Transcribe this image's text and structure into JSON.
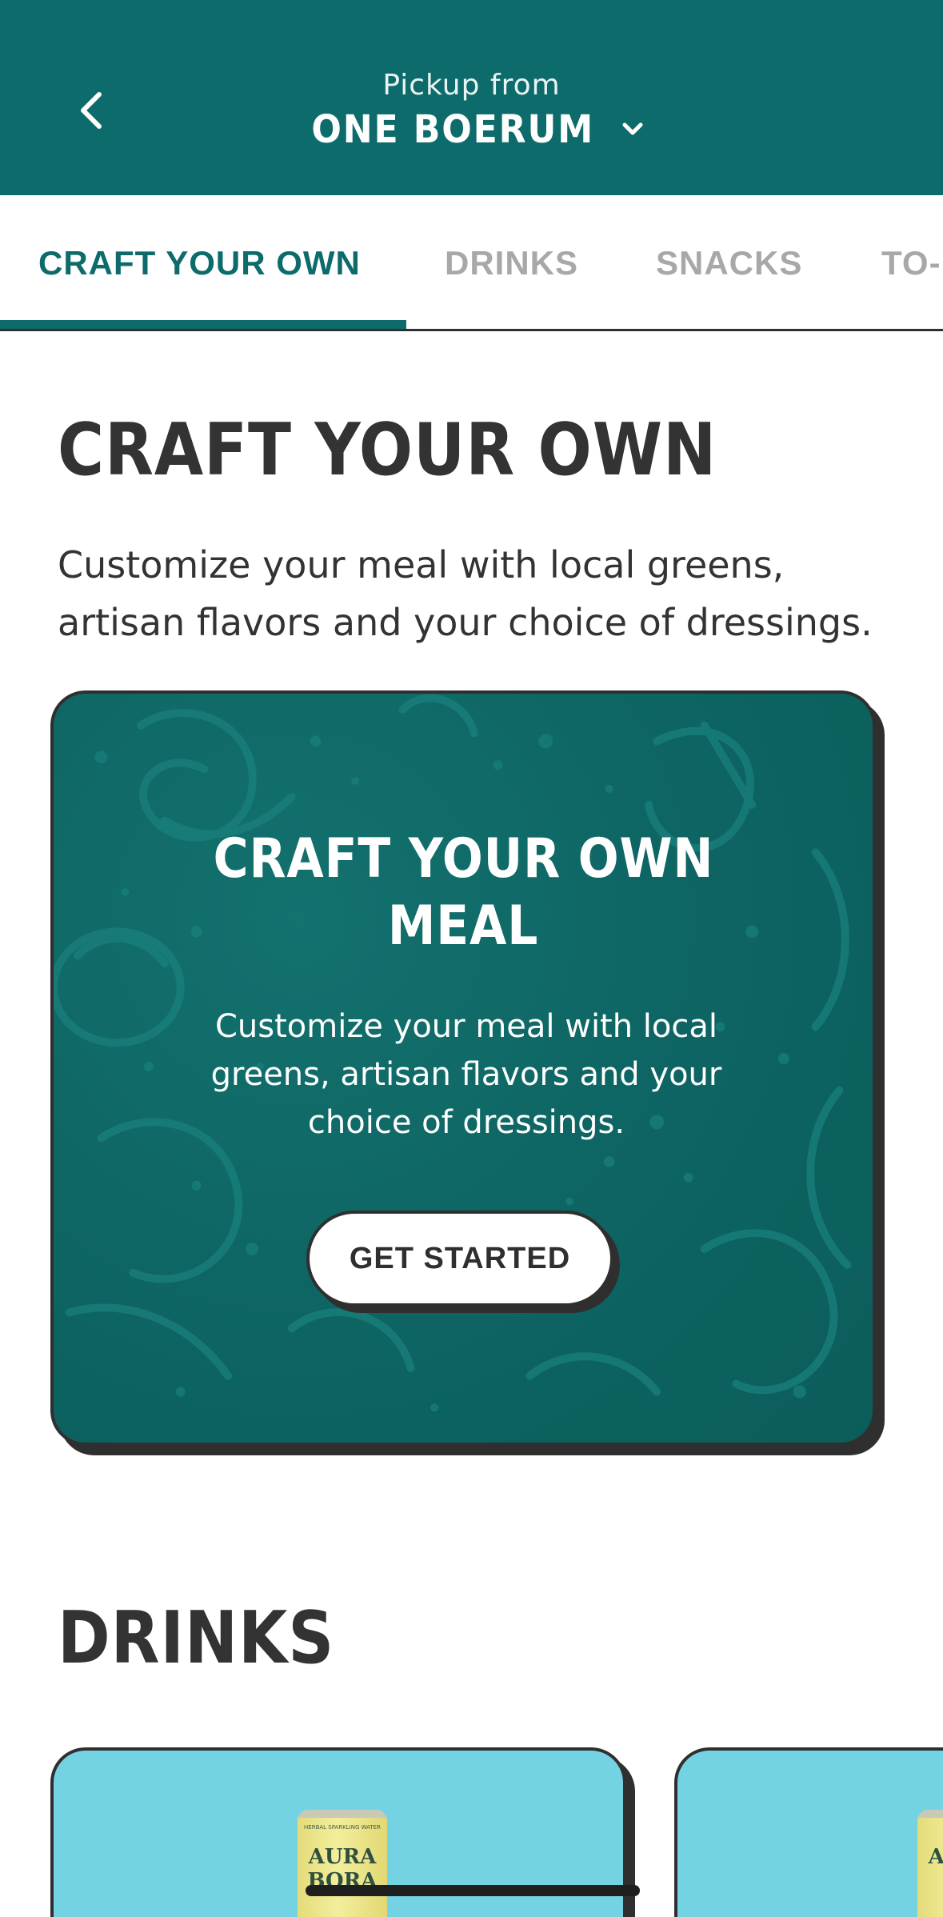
{
  "header": {
    "pickup_label": "Pickup from",
    "location_name": "ONE BOERUM"
  },
  "tabs": [
    {
      "label": "CRAFT YOUR OWN",
      "active": true
    },
    {
      "label": "DRINKS",
      "active": false
    },
    {
      "label": "SNACKS",
      "active": false
    },
    {
      "label": "TO-",
      "active": false
    }
  ],
  "craft_section": {
    "title": "CRAFT YOUR OWN",
    "description": "Customize your meal with local greens, artisan flavors and your choice of dressings.",
    "card": {
      "title_line1": "CRAFT YOUR OWN",
      "title_line2": "MEAL",
      "description": "Customize your meal with local greens, artisan flavors and your choice of dressings.",
      "cta_label": "GET STARTED"
    }
  },
  "drinks_section": {
    "title": "DRINKS",
    "products": [
      {
        "brand_top": "HERBAL SPARKLING WATER",
        "brand_line1": "AURA",
        "brand_line2": "BORA"
      }
    ]
  },
  "colors": {
    "brand_teal": "#0e6b6b",
    "tab_inactive": "#a8a8a8",
    "heading_text": "#333333",
    "drink_card_bg": "#74d3e2"
  },
  "icons": {
    "back": "chevron-left-icon",
    "location_dropdown": "chevron-down-icon"
  }
}
